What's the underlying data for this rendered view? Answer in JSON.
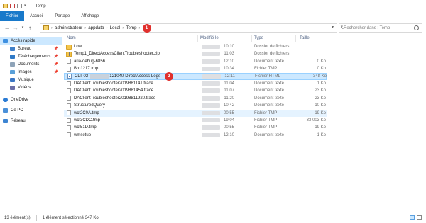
{
  "window": {
    "title": "Temp"
  },
  "ribbon": {
    "tabs": [
      "Fichier",
      "Accueil",
      "Partage",
      "Affichage"
    ]
  },
  "address": {
    "crumbs": [
      "administrateur",
      "appdata",
      "Local",
      "Temp"
    ],
    "badge": "1"
  },
  "search": {
    "placeholder": "Rechercher dans : Temp"
  },
  "sidebar": {
    "items": [
      {
        "label": "Accès rapide",
        "icon": "star-icon",
        "pinned": false
      },
      {
        "label": "Bureau",
        "icon": "desktop-icon",
        "pinned": true
      },
      {
        "label": "Téléchargements",
        "icon": "download-icon",
        "pinned": true
      },
      {
        "label": "Documents",
        "icon": "document-icon",
        "pinned": true
      },
      {
        "label": "Images",
        "icon": "image-icon",
        "pinned": true
      },
      {
        "label": "Musique",
        "icon": "music-icon",
        "pinned": false
      },
      {
        "label": "Vidéos",
        "icon": "video-icon",
        "pinned": false
      },
      {
        "label": "OneDrive",
        "icon": "cloud-icon",
        "pinned": false
      },
      {
        "label": "Ce PC",
        "icon": "computer-icon",
        "pinned": false
      },
      {
        "label": "Réseau",
        "icon": "network-icon",
        "pinned": false
      }
    ]
  },
  "columns": {
    "name": "Nom",
    "date": "Modifié le",
    "type": "Type",
    "size": "Taille"
  },
  "files": [
    {
      "name": "Low",
      "date": "10:10",
      "type": "Dossier de fichiers",
      "size": "",
      "kind": "folder"
    },
    {
      "name": "Temp1_DirectAccessClientTroubleshooter.zip",
      "date": "11:03",
      "type": "Dossier de fichiers",
      "size": "",
      "kind": "zip"
    },
    {
      "name": "aria-debug-6856",
      "date": "12:10",
      "type": "Document texte",
      "size": "0 Ko",
      "kind": "text"
    },
    {
      "name": "Bro1217.tmp",
      "date": "10:34",
      "type": "Fichier TMP",
      "size": "0 Ko",
      "kind": "text"
    },
    {
      "name": "CLT-02-",
      "name_suffix": "121040-DirectAccess Logs",
      "date": "12:11",
      "type": "Fichier HTML",
      "size": "348 Ko",
      "kind": "html",
      "selected": true,
      "badge": "2"
    },
    {
      "name": "DAClientTroubleshooter2019881141.trace",
      "date": "11:04",
      "type": "Document texte",
      "size": "1 Ko",
      "kind": "text"
    },
    {
      "name": "DAClientTroubleshooter2019881454.trace",
      "date": "11:07",
      "type": "Document texte",
      "size": "23 Ko",
      "kind": "text"
    },
    {
      "name": "DAClientTroubleshooter20198811920.trace",
      "date": "11:20",
      "type": "Document texte",
      "size": "23 Ko",
      "kind": "text"
    },
    {
      "name": "StructuredQuery",
      "date": "10:42",
      "type": "Document texte",
      "size": "10 Ko",
      "kind": "text"
    },
    {
      "name": "wct2C0A.tmp",
      "date": "00:55",
      "type": "Fichier TMP",
      "size": "19 Ko",
      "kind": "text",
      "hover": true
    },
    {
      "name": "wct3CDC.tmp",
      "date": "19:04",
      "type": "Fichier TMP",
      "size": "33 003 Ko",
      "kind": "text"
    },
    {
      "name": "wct51D.tmp",
      "date": "00:55",
      "type": "Fichier TMP",
      "size": "19 Ko",
      "kind": "text"
    },
    {
      "name": "wmsetup",
      "date": "12:10",
      "type": "Document texte",
      "size": "1 Ko",
      "kind": "text"
    }
  ],
  "status": {
    "count": "13 élément(s)",
    "selection": "1 élément sélectionné  347 Ko"
  },
  "colors": {
    "accent": "#1979ca",
    "selection": "#cce8ff",
    "badge": "#e0302d"
  }
}
